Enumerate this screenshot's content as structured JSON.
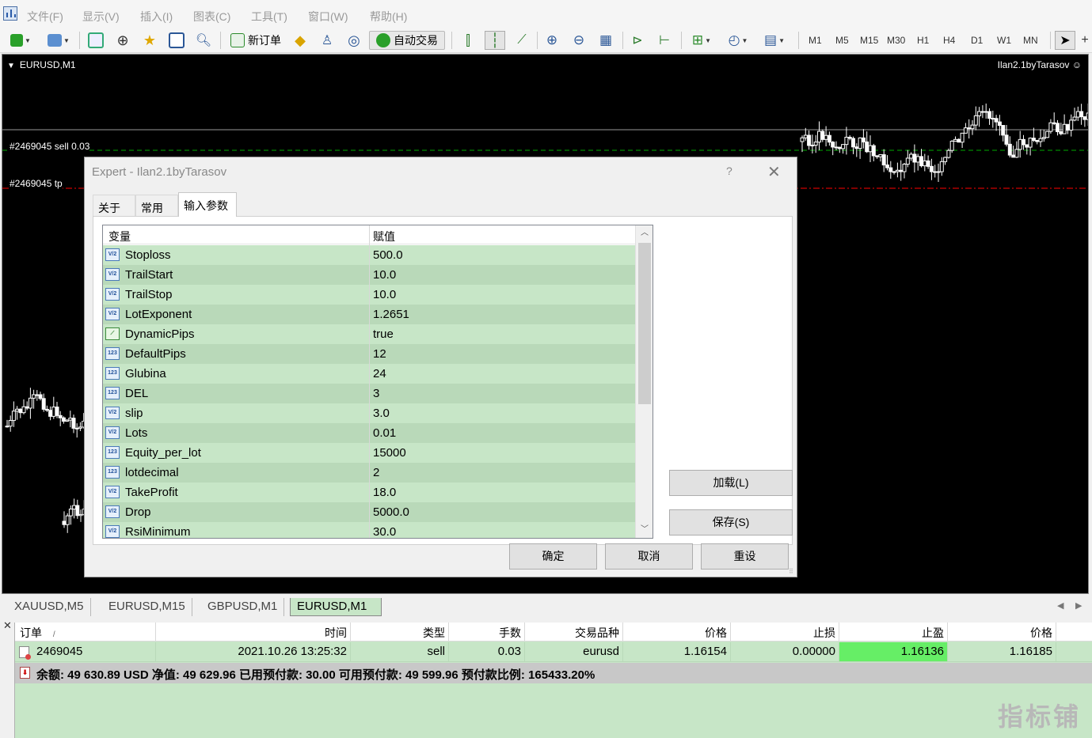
{
  "menu": [
    "文件(F)",
    "显示(V)",
    "插入(I)",
    "图表(C)",
    "工具(T)",
    "窗口(W)",
    "帮助(H)"
  ],
  "toolbar": {
    "new_order": "新订单",
    "auto_trading": "自动交易",
    "timeframes": [
      "M1",
      "M5",
      "M15",
      "M30",
      "H1",
      "H4",
      "D1",
      "W1",
      "MN"
    ]
  },
  "chart": {
    "symbol_title": "EURUSD,M1",
    "expert_label": "Ilan2.1byTarasov",
    "sell_line_label": "#2469045 sell 0.03",
    "tp_line_label": "#2469045 tp",
    "colors": {
      "background": "#000000",
      "candle": "#ffffff",
      "bull": "#00ff00",
      "sell_line": "#00aa00",
      "tp_line": "#ff0000"
    }
  },
  "dialog": {
    "title": "Expert - Ilan2.1byTarasov",
    "help": "?",
    "tabs": [
      "关于",
      "常用",
      "输入参数"
    ],
    "active_tab": "输入参数",
    "columns": {
      "variable": "变量",
      "value": "赋值"
    },
    "params": [
      {
        "name": "Stoploss",
        "value": "500.0",
        "icon": "V/2"
      },
      {
        "name": "TrailStart",
        "value": "10.0",
        "icon": "V/2"
      },
      {
        "name": "TrailStop",
        "value": "10.0",
        "icon": "V/2"
      },
      {
        "name": "LotExponent",
        "value": "1.2651",
        "icon": "V/2"
      },
      {
        "name": "DynamicPips",
        "value": "true",
        "icon": "bool"
      },
      {
        "name": "DefaultPips",
        "value": "12",
        "icon": "123"
      },
      {
        "name": "Glubina",
        "value": "24",
        "icon": "123"
      },
      {
        "name": "DEL",
        "value": "3",
        "icon": "123"
      },
      {
        "name": "slip",
        "value": "3.0",
        "icon": "V/2"
      },
      {
        "name": "Lots",
        "value": "0.01",
        "icon": "V/2"
      },
      {
        "name": "Equity_per_lot",
        "value": "15000",
        "icon": "123"
      },
      {
        "name": "lotdecimal",
        "value": "2",
        "icon": "123"
      },
      {
        "name": "TakeProfit",
        "value": "18.0",
        "icon": "V/2"
      },
      {
        "name": "Drop",
        "value": "5000.0",
        "icon": "V/2"
      },
      {
        "name": "RsiMinimum",
        "value": "30.0",
        "icon": "V/2"
      }
    ],
    "load_button": "加载(L)",
    "save_button": "保存(S)",
    "ok_button": "确定",
    "cancel_button": "取消",
    "reset_button": "重设"
  },
  "chart_tabs": [
    "XAUUSD,M5",
    "EURUSD,M15",
    "GBPUSD,M1",
    "EURUSD,M1"
  ],
  "active_chart_tab": "EURUSD,M1",
  "terminal": {
    "headers": [
      "订单",
      "时间",
      "类型",
      "手数",
      "交易品种",
      "价格",
      "止损",
      "止盈",
      "价格"
    ],
    "sort_indicator": "/",
    "order": {
      "ticket": "2469045",
      "time": "2021.10.26 13:25:32",
      "type": "sell",
      "lots": "0.03",
      "symbol": "eurusd",
      "open_price": "1.16154",
      "sl": "0.00000",
      "tp": "1.16136",
      "price": "1.16185"
    },
    "summary": "余额: 49 630.89 USD  净值: 49 629.96  已用预付款: 30.00  可用预付款: 49 599.96  预付款比例: 165433.20%"
  },
  "watermark": "指标铺"
}
